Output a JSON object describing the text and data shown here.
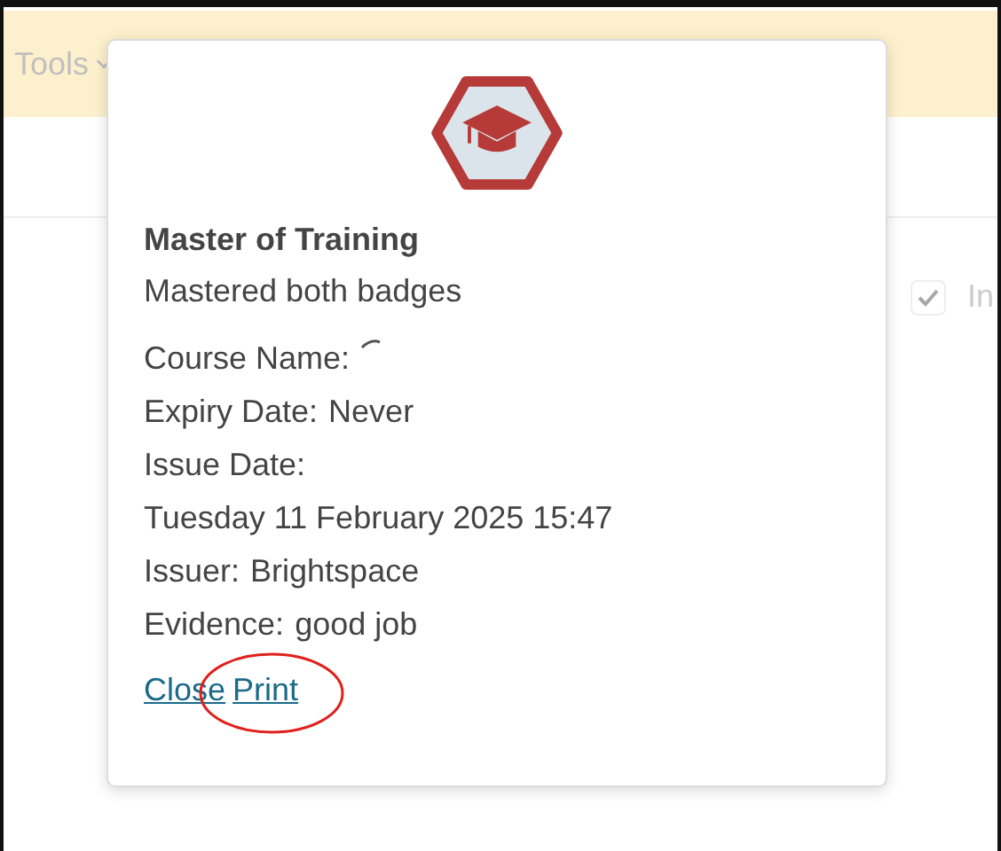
{
  "background": {
    "menu": "Tools",
    "checkbox": {
      "checked": true,
      "label": "In"
    }
  },
  "popup": {
    "title": "Master of Training",
    "description": "Mastered both badges",
    "fields": [
      {
        "kind": "pending",
        "label": "Course Name:"
      },
      {
        "kind": "text",
        "label": "Expiry Date:",
        "value": "Never"
      },
      {
        "kind": "text",
        "label": "Issue Date:"
      },
      {
        "kind": "text",
        "value": "Tuesday 11 February 2025 15:47"
      },
      {
        "kind": "text",
        "label": "Issuer:",
        "value": "Brightspace"
      },
      {
        "kind": "text",
        "label": "Evidence:",
        "value": "good job"
      }
    ],
    "links": [
      "Close",
      "Print"
    ],
    "annotation": {
      "kind": "circle"
    }
  }
}
